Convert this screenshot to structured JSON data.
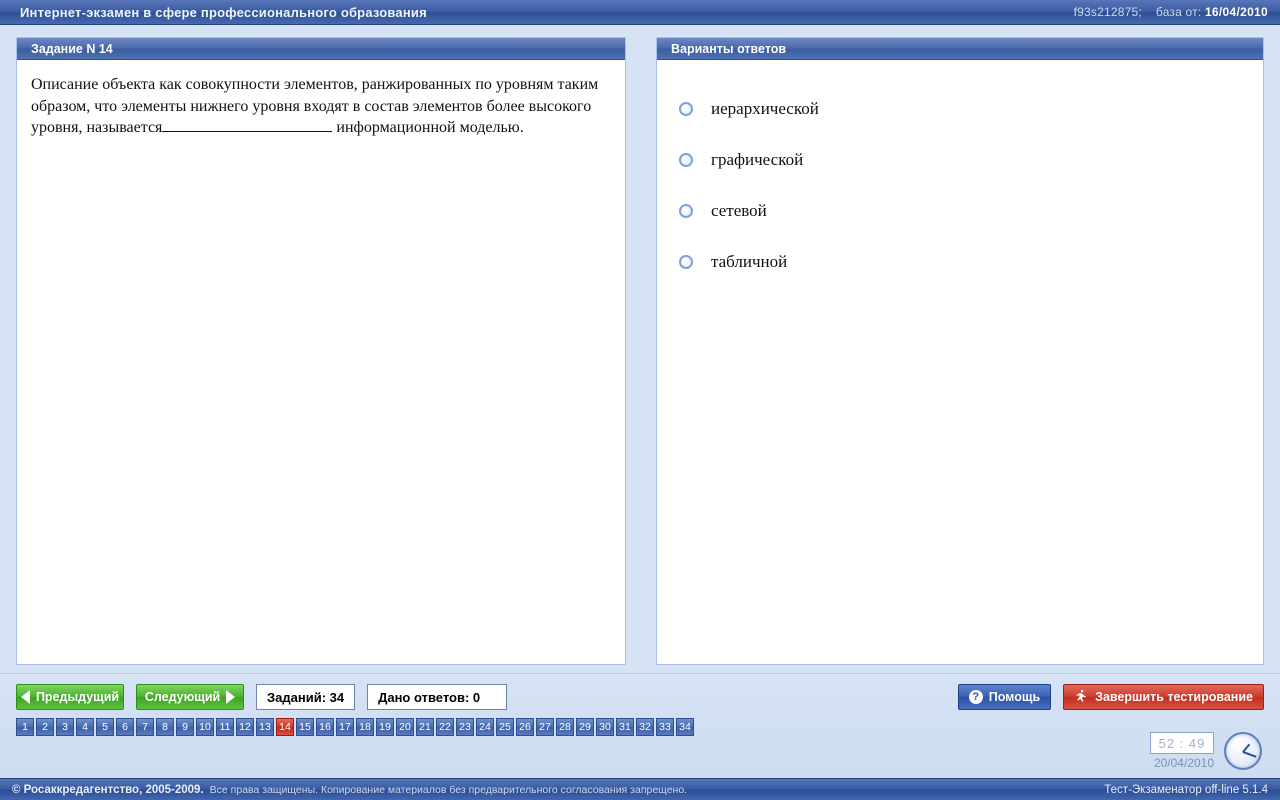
{
  "titlebar": {
    "title": "Интернет-экзамен в сфере профессионального образования",
    "session_id": "f93s212875;",
    "db_label": "база от:",
    "db_date": "16/04/2010"
  },
  "question_panel": {
    "header": "Задание N 14",
    "text_before": "Описание объекта как совокупности элементов, ранжированных по уровням таким образом, что элементы нижнего уровня входят в состав элементов более высокого уровня, называется",
    "text_after": " информационной  моделью."
  },
  "answers_panel": {
    "header": "Варианты ответов",
    "options": [
      "иерархической",
      "графической",
      "сетевой",
      "табличной"
    ]
  },
  "controls": {
    "prev_label": "Предыдущий",
    "next_label": "Следующий",
    "total_label": "Заданий: 34",
    "answered_label": "Дано ответов:  0",
    "help_label": "Помощь",
    "finish_label": "Завершить тестирование"
  },
  "pager": {
    "count": 34,
    "current": 14
  },
  "clock": {
    "time": "52 : 49",
    "date": "20/04/2010"
  },
  "footer": {
    "copyright": "© Росаккредагентство, 2005-2009.",
    "note": "Все права защищены. Копирование материалов без предварительного согласования запрещено.",
    "version": "Тест-Экзаменатор off-line 5.1.4"
  }
}
